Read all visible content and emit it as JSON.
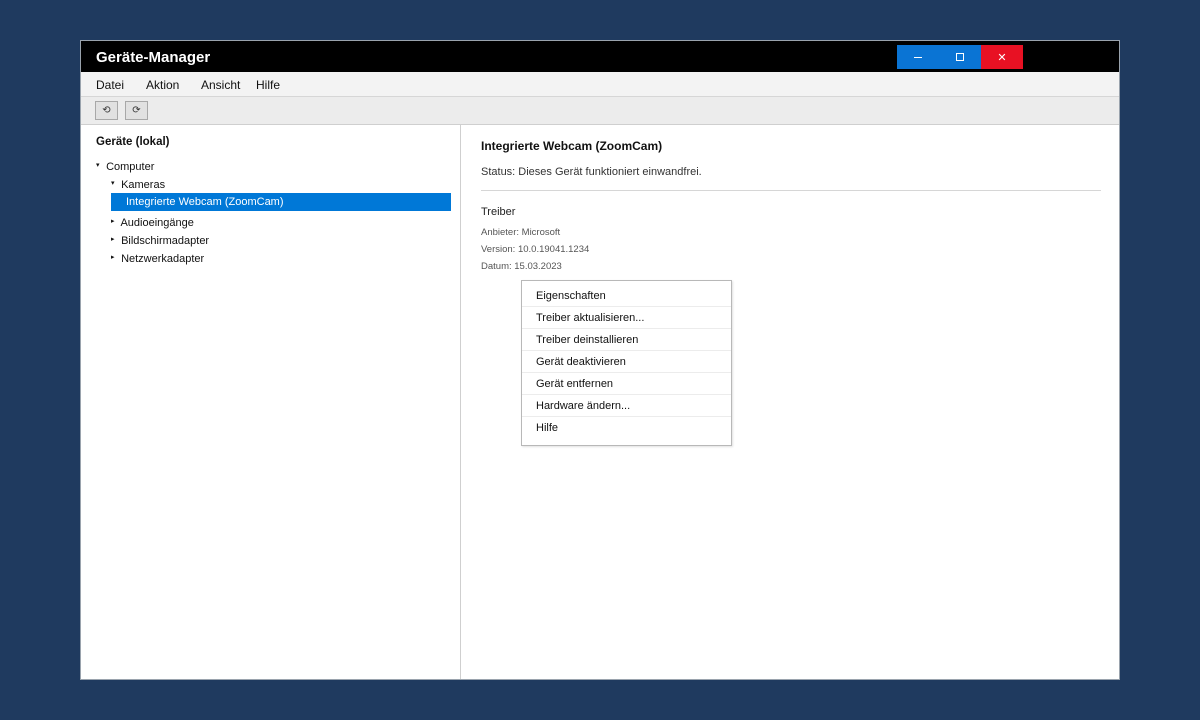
{
  "window": {
    "title": "Geräte-Manager",
    "controls": {
      "minimize": "",
      "maximize": "",
      "close": "✕"
    }
  },
  "menubar": {
    "items": [
      "Datei",
      "Aktion",
      "Ansicht",
      "Hilfe"
    ]
  },
  "toolbar": {
    "back_glyph": "⟲",
    "forward_glyph": "⟳",
    "back_icon": "back-icon",
    "forward_icon": "forward-icon"
  },
  "tree": {
    "heading": "Geräte (lokal)",
    "expanded_glyph": "▾",
    "collapsed_glyph": "▸",
    "nodes": {
      "computer": "Computer",
      "kameras": "Kameras",
      "webcam": "Integrierte Webcam (ZoomCam)",
      "audio": "Audioeingänge",
      "display": "Bildschirmadapter",
      "network": "Netzwerkadapter"
    },
    "selected_node": "Integrierte Webcam (ZoomCam)"
  },
  "details": {
    "device_title": "Integrierte Webcam (ZoomCam)",
    "status": "Status: Dieses Gerät funktioniert einwandfrei.",
    "driver_heading": "Treiber",
    "driver_vendor": "Anbieter: Microsoft",
    "driver_version": "Version: 10.0.19041.1234",
    "driver_date": "Datum: 15.03.2023"
  },
  "context_menu": {
    "items": [
      "Eigenschaften",
      "Treiber aktualisieren...",
      "Treiber deinstallieren",
      "Gerät deaktivieren",
      "Gerät entfernen",
      "Hardware ändern...",
      "Hilfe"
    ]
  },
  "colors": {
    "background": "#1f3a5f",
    "titlebar": "#000000",
    "accent": "#0078d7",
    "window_button_blue": "#0a74d4",
    "close_red": "#e81123"
  }
}
